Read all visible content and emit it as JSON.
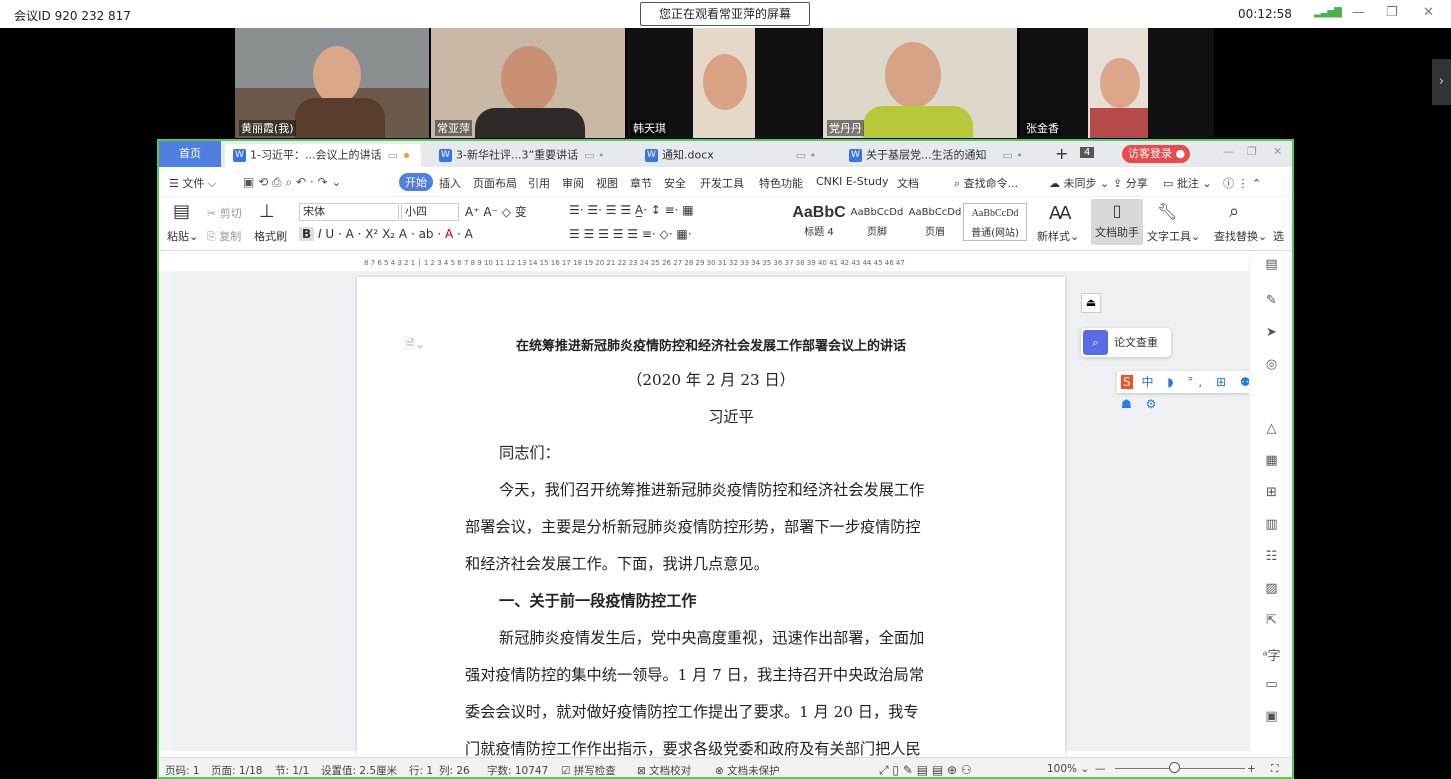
{
  "meeting": {
    "id": "会议ID 920 232 817",
    "share_banner": "您正在观看常亚萍的屏幕",
    "elapsed": "00:12:58",
    "participants": [
      "黄丽霞(我)",
      "常亚萍",
      "韩天琪",
      "党丹丹",
      "张金香"
    ]
  },
  "tabs": {
    "home": "首页",
    "doc1": "1-习近平：...会议上的讲话",
    "doc2": "3-新华社评...3”重要讲话",
    "doc3": "通知.docx",
    "doc4": "关于基层党...生活的通知",
    "count": "4",
    "login": "访客登录"
  },
  "menu": {
    "file": "文件",
    "start": "开始",
    "insert": "插入",
    "layout": "页面布局",
    "ref": "引用",
    "review": "审阅",
    "view": "视图",
    "chapter": "章节",
    "security": "安全",
    "dev": "开发工具",
    "special": "特色功能",
    "cnki": "CNKI E-Study",
    "docsmall": "文档",
    "search": "查找命令...",
    "sync": "未同步",
    "share": "分享",
    "annot": "批注"
  },
  "ribbon": {
    "paste": "粘贴",
    "cut": "剪切",
    "copy": "复制",
    "format_painter": "格式刷",
    "font": "宋体",
    "size": "小四",
    "styles": [
      {
        "sample": "AaBbC",
        "name": "标题 4"
      },
      {
        "sample": "AaBbCcDd",
        "name": "页脚"
      },
      {
        "sample": "AaBbCcDd",
        "name": "页眉"
      },
      {
        "sample": "AaBbCcDd",
        "name": "普通(网站)"
      }
    ],
    "new_style": "新样式",
    "doc_helper": "文档助手",
    "text_tool": "文字工具",
    "find_replace": "查找替换",
    "select": "选"
  },
  "ruler": "8 7 6 5 4 3 2 1 │ 1 2 3 4 5 6 7 8 9 10 11 12 13 14 15 16 17 18 19 20 21 22 23 24 25 26 27 28 29 30 31 32 33 34 35 36 37 38 39 40 41 42 43 44 45 46 47",
  "document": {
    "title": "在统筹推进新冠肺炎疫情防控和经济社会发展工作部署会议上的讲话",
    "date": "（2020 年 2 月 23 日）",
    "author": "习近平",
    "salutation": "同志们：",
    "p1": [
      "今天，我们召开统筹推进新冠肺炎疫情防控和经济社会发展工作",
      "部署会议，主要是分析新冠肺炎疫情防控形势，部署下一步疫情防控",
      "和经济社会发展工作。下面，我讲几点意见。"
    ],
    "heading1": "一、关于前一段疫情防控工作",
    "p2": [
      "新冠肺炎疫情发生后，党中央高度重视，迅速作出部署，全面加",
      "强对疫情防控的集中统一领导。1 月 7 日，我主持召开中央政治局常",
      "委会会议时，就对做好疫情防控工作提出了要求。1 月 20 日，我专",
      "门就疫情防控工作作出指示，要求各级党委和政府及有关部门把人民"
    ]
  },
  "sidepanel": {
    "paper_check": "论文查重",
    "ime": "中 ◗ °, ⊞ ⚉ 简 ☗ ⚙"
  },
  "status": {
    "page_code": "页码: 1",
    "pages": "页面: 1/18",
    "section": "节: 1/1",
    "setting": "设置值: 2.5厘米",
    "row": "行: 1",
    "col": "列: 26",
    "words": "字数: 10747",
    "spell": "拼写检查",
    "proof": "文档校对",
    "protect": "文档未保护",
    "zoom": "100%"
  },
  "colors": {
    "accent": "#4f7fe0",
    "frame": "#58c85a",
    "login": "#e84b4b"
  }
}
